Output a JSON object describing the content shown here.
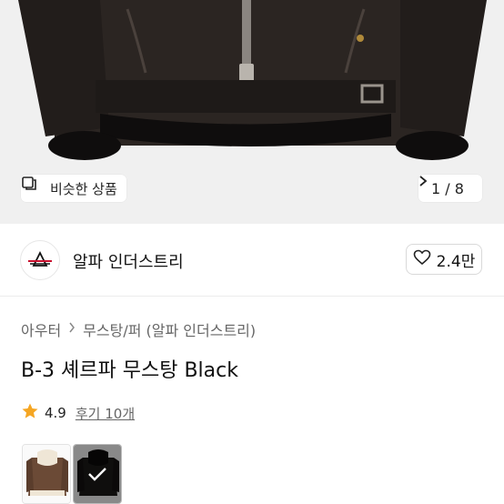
{
  "hero": {
    "similar_label": "비슷한 상품",
    "counter": "1 / 8"
  },
  "brand": {
    "name": "알파 인더스트리",
    "likes": "2.4만"
  },
  "breadcrumb": {
    "category": "아우터",
    "subcategory": "무스탕/퍼 (알파 인더스트리)"
  },
  "product": {
    "title": "B-3 셰르파 무스탕 Black",
    "rating": "4.9",
    "reviews": "후기 10개"
  },
  "colors": {
    "star": "#F5A623",
    "brand_red": "#C8102E"
  }
}
